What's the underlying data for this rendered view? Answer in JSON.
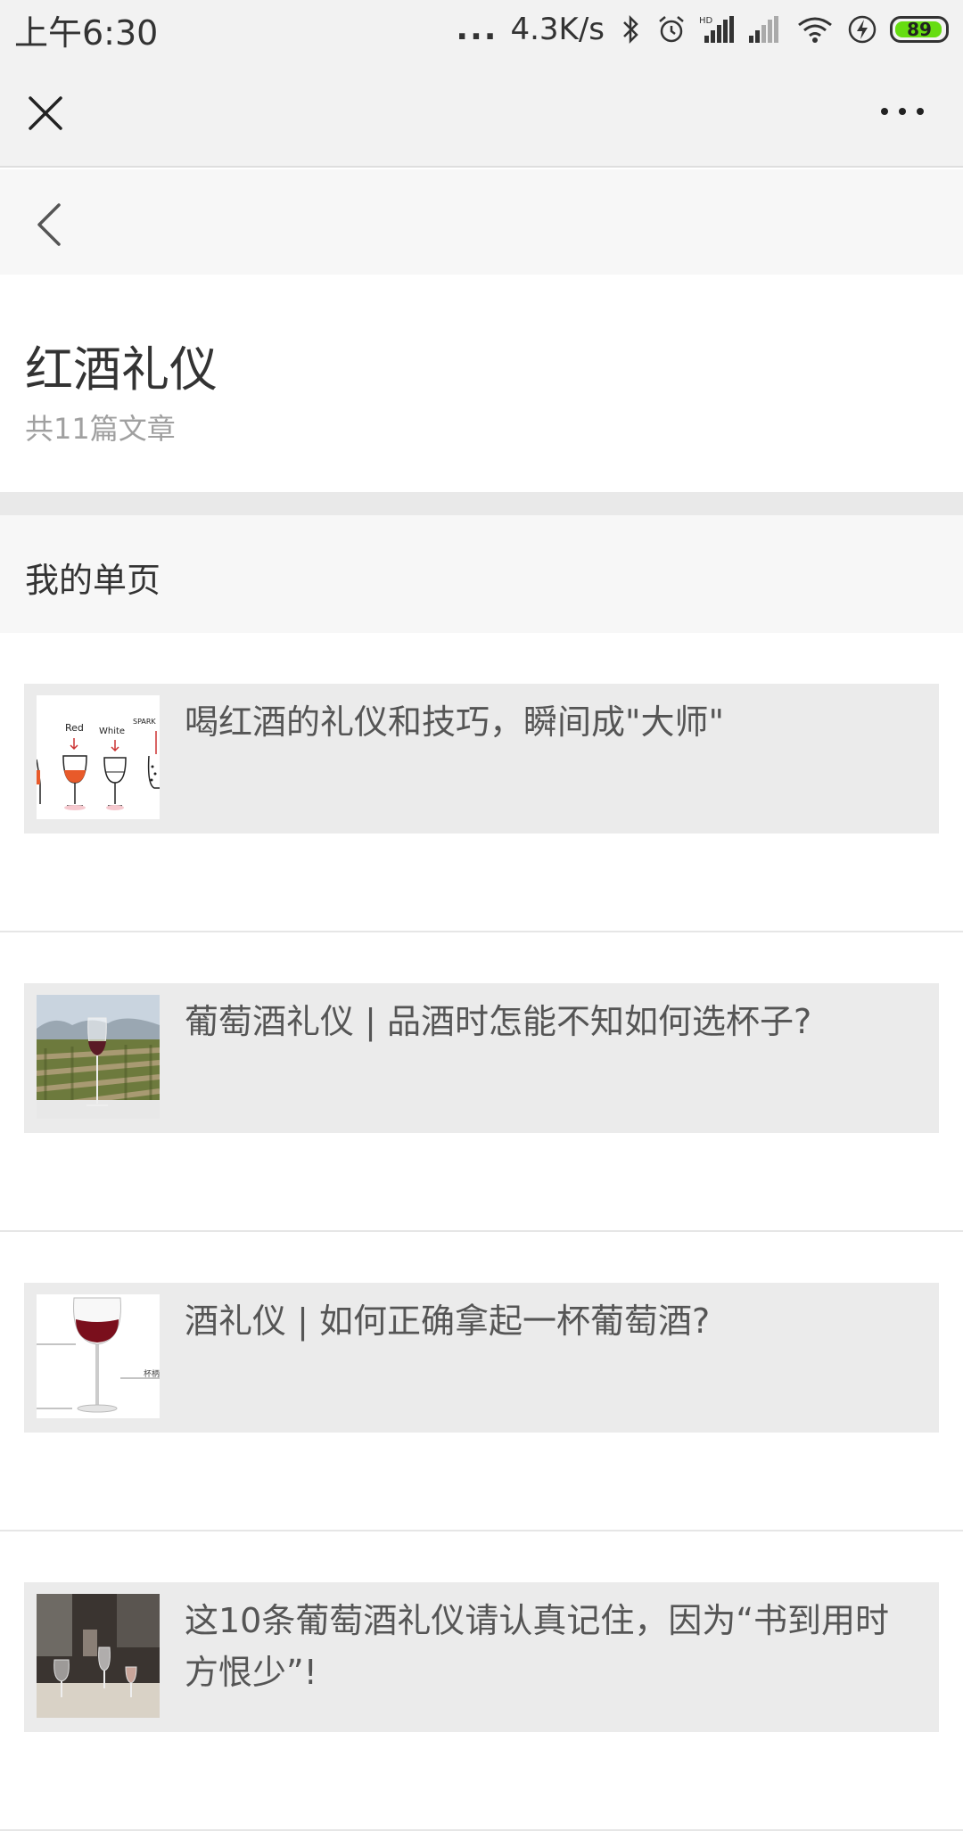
{
  "status_bar": {
    "time": "上午6:30",
    "dots": "...",
    "network_speed": "4.3K/s",
    "battery_level": "89",
    "battery_color": "#66dd11",
    "icons": [
      "bluetooth-icon",
      "alarm-icon",
      "signal-hd-icon",
      "signal-icon",
      "wifi-icon",
      "charging-icon",
      "battery-icon"
    ]
  },
  "title_bar": {
    "close_icon": "close-icon",
    "more_icon": "more-icon"
  },
  "nav": {
    "back_icon": "chevron-left-icon"
  },
  "header": {
    "title": "红酒礼仪",
    "count": "共11篇文章"
  },
  "section": {
    "title": "我的单页"
  },
  "articles": [
    {
      "title": "喝红酒的礼仪和技巧，瞬间成\"大师\"",
      "thumb_labels": [
        "Red",
        "White",
        "SPARK"
      ]
    },
    {
      "title": "葡萄酒礼仪 | 品酒时怎能不知如何选杯子?"
    },
    {
      "title": "酒礼仪 | 如何正确拿起一杯葡萄酒?",
      "thumb_labels": [
        "杯柄"
      ]
    },
    {
      "title": "这10条葡萄酒礼仪请认真记住，因为“书到用时方恨少”!"
    }
  ]
}
